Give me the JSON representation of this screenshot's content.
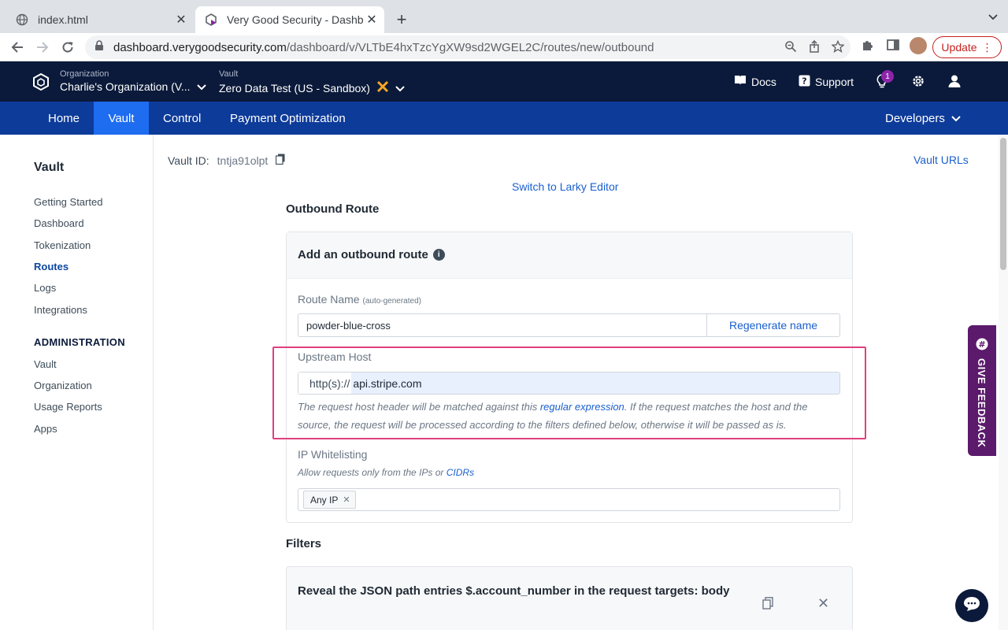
{
  "browser": {
    "tabs": [
      {
        "title": "index.html",
        "icon": "globe-icon"
      },
      {
        "title": "Very Good Security - Dashboard",
        "icon": "vgs-icon"
      }
    ],
    "url_domain": "dashboard.verygoodsecurity.com",
    "url_path": "/dashboard/v/VLTbE4hxTzcYgXW9sd2WGEL2C/routes/new/outbound",
    "update_label": "Update"
  },
  "header": {
    "org_label": "Organization",
    "org_value": "Charlie's Organization (V...",
    "vault_label": "Vault",
    "vault_value": "Zero Data Test  (US - Sandbox)",
    "docs": "Docs",
    "support": "Support",
    "notif_count": "1"
  },
  "nav": {
    "items": [
      "Home",
      "Vault",
      "Control",
      "Payment Optimization"
    ],
    "developers": "Developers"
  },
  "sidebar": {
    "title": "Vault",
    "items": [
      "Getting Started",
      "Dashboard",
      "Tokenization",
      "Routes",
      "Logs",
      "Integrations"
    ],
    "admin_title": "ADMINISTRATION",
    "admin_items": [
      "Vault",
      "Organization",
      "Usage Reports",
      "Apps"
    ]
  },
  "content": {
    "vault_id_label": "Vault ID:",
    "vault_id_value": "tntja91olpt",
    "vault_urls": "Vault URLs",
    "larky_link": "Switch to Larky Editor",
    "section_title": "Outbound Route",
    "card_title": "Add an outbound route",
    "route_name_label": "Route Name",
    "route_name_hint": "(auto-generated)",
    "route_name_value": "powder-blue-cross",
    "regenerate_label": "Regenerate name",
    "upstream_label": "Upstream Host",
    "upstream_prefix": "http(s)://",
    "upstream_value": "api.stripe.com",
    "upstream_hint_1": "The request host header will be matched against this ",
    "upstream_hint_link": "regular expression",
    "upstream_hint_2": ". If the request matches the host and the",
    "upstream_hint_3": "source, the request will be processed according to the filters defined below, otherwise it will be passed as is.",
    "ip_label": "IP Whitelisting",
    "ip_hint_1": "Allow requests only from the IPs or ",
    "ip_hint_link": "CIDRs",
    "ip_chip": "Any IP",
    "filters_title": "Filters",
    "filter_text": "Reveal the JSON path entries $.account_number in the request targets: body"
  },
  "feedback_label": "GIVE FEEDBACK"
}
